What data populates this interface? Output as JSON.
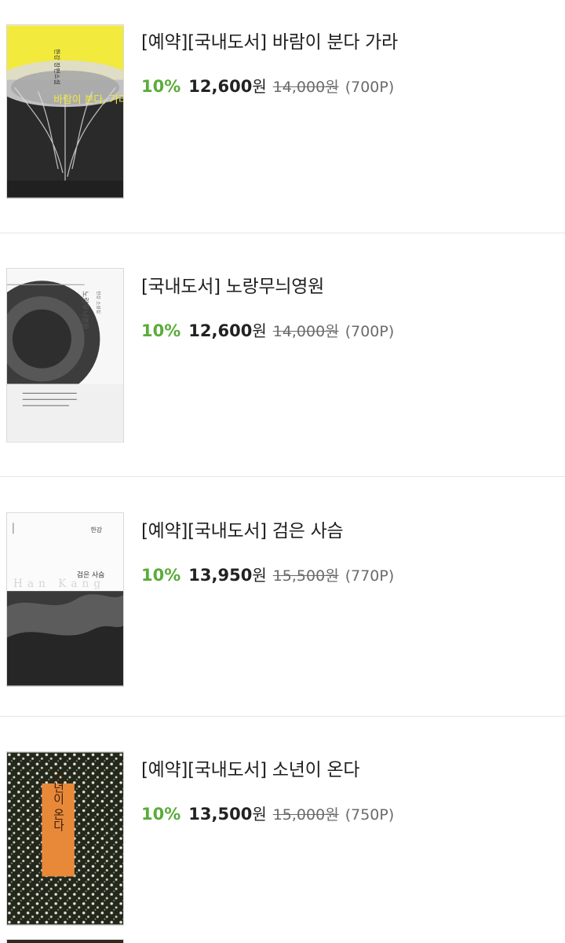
{
  "books": [
    {
      "title": "[예약][국내도서] 바람이 분다 가라",
      "discount": "10%",
      "price": "12,600",
      "currency": "원",
      "original_price": "14,000원",
      "points": "(700P)",
      "cover": {
        "author": "한강 장편소설",
        "title": "바람이 분다, 가라",
        "bg_color": "#f2ea3c"
      }
    },
    {
      "title": "[국내도서] 노랑무늬영원",
      "discount": "10%",
      "price": "12,600",
      "currency": "원",
      "original_price": "14,000원",
      "points": "(700P)",
      "cover": {
        "author": "한강 소설집",
        "title": "노랑무늬영원"
      }
    },
    {
      "title": "[예약][국내도서] 검은 사슴",
      "discount": "10%",
      "price": "13,950",
      "currency": "원",
      "original_price": "15,500원",
      "points": "(770P)",
      "cover": {
        "author": "한강",
        "title": "검은 사슴",
        "latin": "Han Kang"
      }
    },
    {
      "title": "[예약][국내도서] 소년이 온다",
      "discount": "10%",
      "price": "13,500",
      "currency": "원",
      "original_price": "15,000원",
      "points": "(750P)",
      "cover": {
        "title": "소년이 온다",
        "label_color": "#e8893a"
      }
    }
  ],
  "colors": {
    "discount": "#5aac3a",
    "divider": "#e6e6e6"
  }
}
